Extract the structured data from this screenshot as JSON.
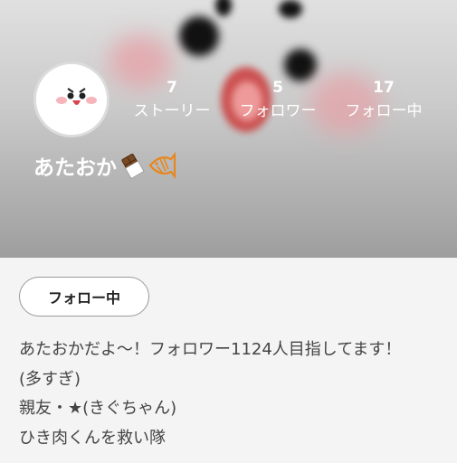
{
  "profile": {
    "name": "あたおか",
    "name_emojis": [
      "chocolate-bar-icon",
      "fish-icon"
    ]
  },
  "stats": [
    {
      "value": "7",
      "label": "ストーリー"
    },
    {
      "value": "5",
      "label": "フォロワー"
    },
    {
      "value": "17",
      "label": "フォロー中"
    }
  ],
  "follow_button": {
    "label": "フォロー中"
  },
  "bio": {
    "lines": [
      "あたおかだよ〜！フォロワー1124人目指してます！",
      "(多すぎ)",
      "親友・★(きぐちゃん)",
      "ひき肉くんを救い隊"
    ]
  },
  "colors": {
    "header_top": "#e0e0e0",
    "header_bottom": "#9e9e9e",
    "cheek_pink": "#f2a0a8",
    "emoji_orange": "#e8871e"
  }
}
